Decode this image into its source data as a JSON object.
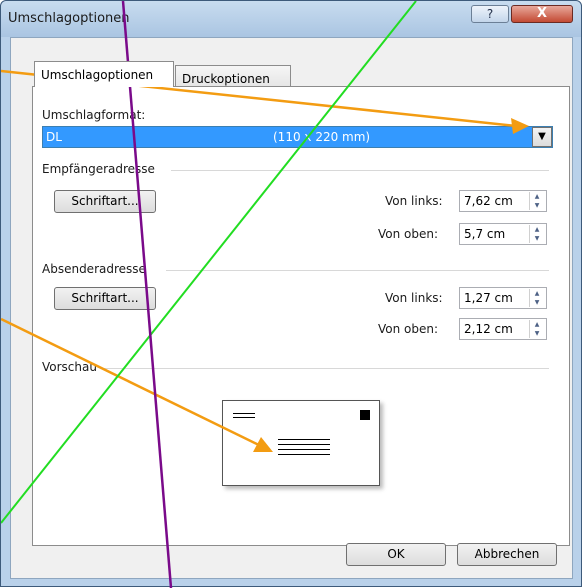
{
  "window": {
    "title": "Umschlagoptionen",
    "help_label": "?",
    "close_label": "X"
  },
  "tabs": [
    {
      "label": "Umschlagoptionen"
    },
    {
      "label": "Druckoptionen"
    }
  ],
  "envelope": {
    "format_label": "Umschlagformat:",
    "format_value": "DL",
    "format_size": "(110 x 220 mm)"
  },
  "recipient": {
    "section_label": "Empfängeradresse",
    "font_button": "Schriftart...",
    "left_label": "Von links:",
    "left_value": "7,62 cm",
    "top_label": "Von oben:",
    "top_value": "5,7 cm"
  },
  "sender": {
    "section_label": "Absenderadresse",
    "font_button": "Schriftart...",
    "left_label": "Von links:",
    "left_value": "1,27 cm",
    "top_label": "Von oben:",
    "top_value": "2,12 cm"
  },
  "preview": {
    "section_label": "Vorschau"
  },
  "buttons": {
    "ok": "OK",
    "cancel": "Abbrechen"
  },
  "colors": {
    "selection": "#3399ff",
    "annotation_orange": "#f39c12",
    "annotation_green": "#22dd22",
    "annotation_purple": "#7a0a8a"
  }
}
